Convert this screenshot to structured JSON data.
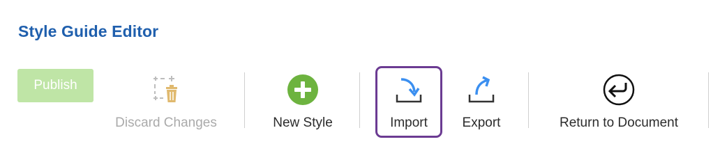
{
  "header": {
    "title": "Style Guide Editor"
  },
  "toolbar": {
    "publish_label": "Publish",
    "discard_label": "Discard Changes",
    "new_style_label": "New Style",
    "import_label": "Import",
    "export_label": "Export",
    "return_label": "Return to Document"
  },
  "colors": {
    "title": "#1f5fad",
    "publish_bg": "#bfe5a6",
    "new_style_icon": "#6db33f",
    "arrow_blue": "#3b8ff0",
    "import_highlight": "#6b3b92",
    "disabled_icon": "#e0b96e"
  },
  "icons": {
    "discard": "discard-trash-icon",
    "new_style": "plus-circle-icon",
    "import": "import-tray-icon",
    "export": "export-tray-icon",
    "return": "return-arrow-circle-icon"
  }
}
